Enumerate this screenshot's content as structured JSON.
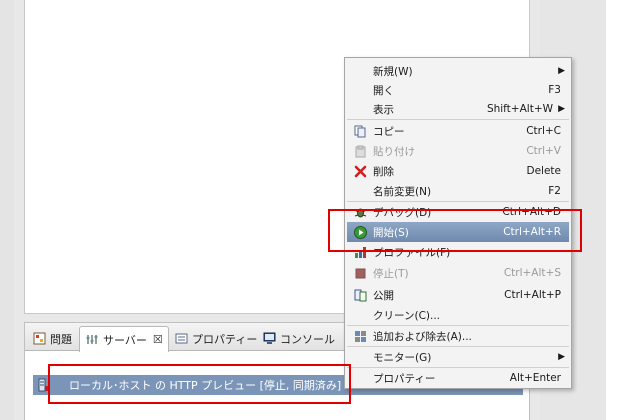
{
  "tabs": [
    {
      "label": "問題",
      "icon": "problems-icon"
    },
    {
      "label": "サーバー",
      "icon": "servers-icon",
      "close": "☒"
    },
    {
      "label": "プロパティー",
      "icon": "properties-icon"
    },
    {
      "label": "コンソール",
      "icon": "console-icon"
    }
  ],
  "server_entry": {
    "label": "ローカル･ホスト の HTTP プレビュー  [停止, 同期済み]",
    "icon": "server-icon"
  },
  "context_menu": {
    "items": [
      {
        "label": "新規(W)",
        "shortcut": "",
        "submenu": true,
        "icon": "",
        "disabled": false
      },
      {
        "label": "開く",
        "shortcut": "F3",
        "submenu": false,
        "icon": "",
        "disabled": false
      },
      {
        "label": "表示",
        "shortcut": "Shift+Alt+W",
        "submenu": true,
        "icon": "",
        "disabled": false
      },
      {
        "label": "コピー",
        "shortcut": "Ctrl+C",
        "submenu": false,
        "icon": "copy-icon",
        "disabled": false
      },
      {
        "label": "貼り付け",
        "shortcut": "Ctrl+V",
        "submenu": false,
        "icon": "paste-icon",
        "disabled": true
      },
      {
        "label": "削除",
        "shortcut": "Delete",
        "submenu": false,
        "icon": "delete-icon",
        "disabled": false
      },
      {
        "label": "名前変更(N)",
        "shortcut": "F2",
        "submenu": false,
        "icon": "",
        "disabled": false
      },
      {
        "label": "デバッグ(D)",
        "shortcut": "Ctrl+Alt+D",
        "submenu": false,
        "icon": "debug-icon",
        "disabled": false
      },
      {
        "label": "開始(S)",
        "shortcut": "Ctrl+Alt+R",
        "submenu": false,
        "icon": "start-icon",
        "disabled": false,
        "highlighted": true
      },
      {
        "label": "プロファイル(F)",
        "shortcut": "",
        "submenu": false,
        "icon": "profile-icon",
        "disabled": false
      },
      {
        "label": "停止(T)",
        "shortcut": "Ctrl+Alt+S",
        "submenu": false,
        "icon": "stop-icon",
        "disabled": true
      },
      {
        "label": "公開",
        "shortcut": "Ctrl+Alt+P",
        "submenu": false,
        "icon": "publish-icon",
        "disabled": false
      },
      {
        "label": "クリーン(C)...",
        "shortcut": "",
        "submenu": false,
        "icon": "",
        "disabled": false
      },
      {
        "label": "追加および除去(A)...",
        "shortcut": "",
        "submenu": false,
        "icon": "add-remove-icon",
        "disabled": false
      },
      {
        "label": "モニター(G)",
        "shortcut": "",
        "submenu": true,
        "icon": "",
        "disabled": false
      },
      {
        "label": "プロパティー",
        "shortcut": "Alt+Enter",
        "submenu": false,
        "icon": "",
        "disabled": false
      }
    ],
    "submenu_arrow": "▶"
  },
  "colors": {
    "highlight": "#7590b6",
    "annotation_red": "#e00000",
    "selection_row": "#7b95b8"
  }
}
